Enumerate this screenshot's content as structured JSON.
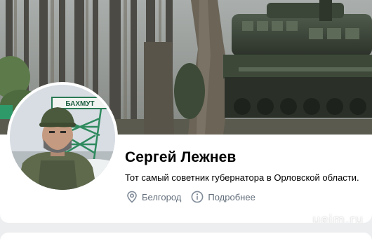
{
  "profile": {
    "name": "Сергей Лежнев",
    "status": "Тот самый советник губернатора в Орловской области.",
    "location": "Белгород",
    "details_link": "Подробнее"
  },
  "avatar": {
    "sign_text": "БАХМУТ"
  },
  "icons": {
    "location": "location-pin-icon",
    "info": "info-circle-icon"
  },
  "colors": {
    "text_primary": "#000000",
    "text_secondary": "#626d7a",
    "card_background": "#ffffff",
    "page_background": "#edeef0"
  },
  "watermark": "ueim.ru"
}
